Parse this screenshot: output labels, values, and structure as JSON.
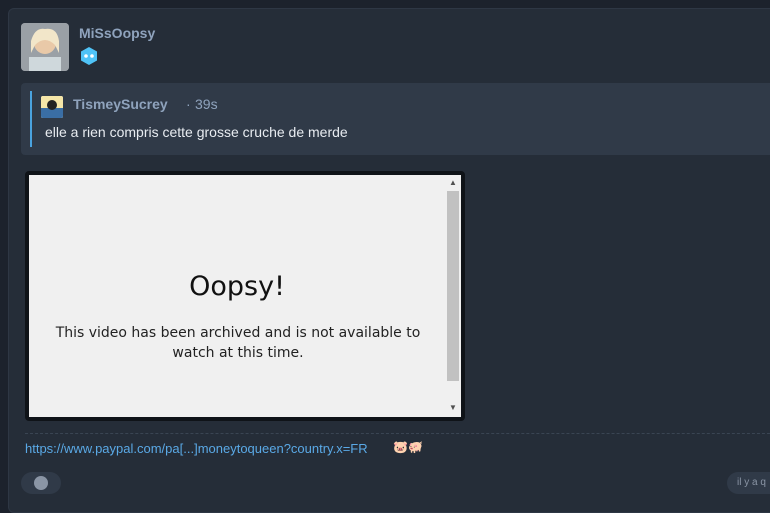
{
  "post": {
    "author": "MiSsOopsy",
    "badge_icon": "diamond-badge-icon",
    "quote": {
      "author": "TismeySucrey",
      "separator": "·",
      "time": "39s",
      "text": "elle a rien compris cette grosse cruche de merde"
    },
    "embed": {
      "title": "Oopsy!",
      "message": "This video has been archived and is not available to watch at this time."
    },
    "link": "https://www.paypal.com/pa[...]moneytoqueen?country.x=FR",
    "link_emoji": "🐷🐖",
    "timestamp": "il y a q"
  },
  "colors": {
    "background": "#252d38",
    "quote_bg": "#303a48",
    "quote_bar": "#4aa3df",
    "username": "#8fa3bd",
    "link": "#5aa9e6",
    "badge": "#4fc3f7"
  }
}
